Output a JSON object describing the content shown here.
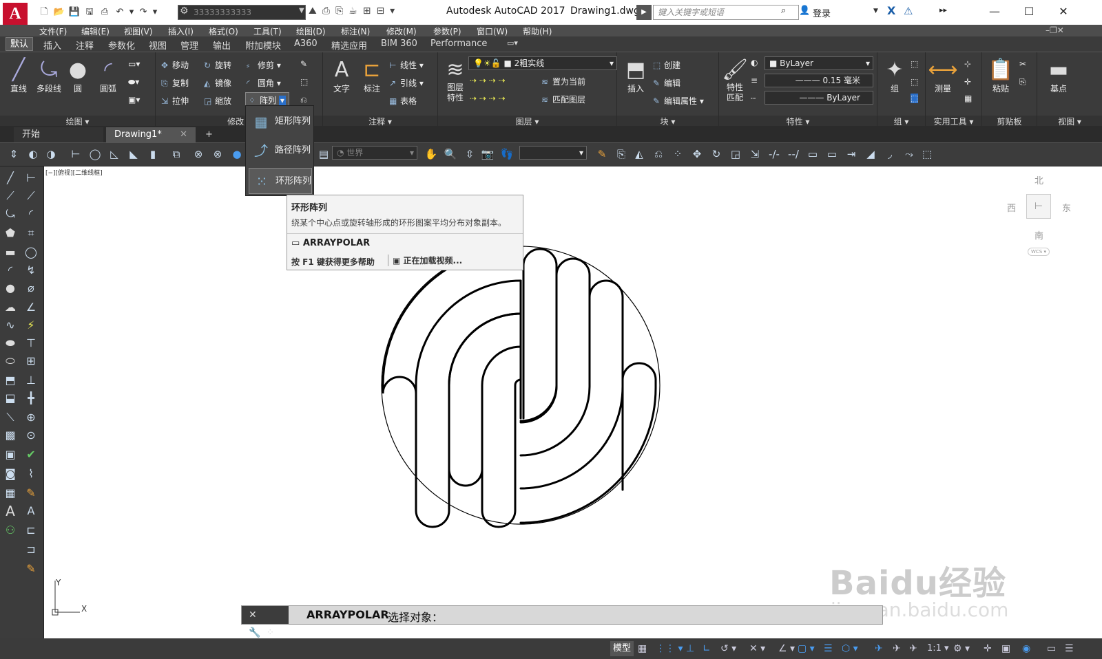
{
  "titlebar": {
    "app_logo": "A",
    "workspace": "33333333333",
    "app_name": "Autodesk AutoCAD 2017",
    "file_name": "Drawing1.dwg",
    "search_placeholder": "键入关键字或短语",
    "login": "登录"
  },
  "menu": [
    "文件(F)",
    "编辑(E)",
    "视图(V)",
    "插入(I)",
    "格式(O)",
    "工具(T)",
    "绘图(D)",
    "标注(N)",
    "修改(M)",
    "参数(P)",
    "窗口(W)",
    "帮助(H)"
  ],
  "ribbon_tabs": [
    "默认",
    "插入",
    "注释",
    "参数化",
    "视图",
    "管理",
    "输出",
    "附加模块",
    "A360",
    "精选应用",
    "BIM 360",
    "Performance"
  ],
  "draw": {
    "line": "直线",
    "polyline": "多段线",
    "circle": "圆",
    "arc": "圆弧",
    "title": "绘图"
  },
  "modify": {
    "move": "移动",
    "rotate": "旋转",
    "trim": "修剪",
    "copy": "复制",
    "mirror": "镜像",
    "fillet": "圆角",
    "stretch": "拉伸",
    "scale": "缩放",
    "array": "阵列",
    "title": "修改"
  },
  "annotation": {
    "text": "文字",
    "dim": "标注",
    "linear": "线性",
    "leader": "引线",
    "table": "表格",
    "title": "注释"
  },
  "layers": {
    "layer_props": "图层\n特性",
    "current_layer": "2粗实线",
    "set_current": "置为当前",
    "match_layer": "匹配图层",
    "title": "图层"
  },
  "block": {
    "insert": "插入",
    "create": "创建",
    "edit": "编辑",
    "edit_attr": "编辑属性",
    "title": "块"
  },
  "properties": {
    "match": "特性\n匹配",
    "color": "ByLayer",
    "lineweight": "0.15 毫米",
    "linetype": "ByLayer",
    "title": "特性"
  },
  "groups": {
    "group": "组",
    "title": "组"
  },
  "utilities": {
    "measure": "测量",
    "title": "实用工具"
  },
  "clipboard": {
    "paste": "粘贴",
    "title": "剪贴板"
  },
  "view": {
    "base": "基点",
    "title": "视图"
  },
  "doc_tabs": {
    "start": "开始",
    "drawing": "Drawing1*",
    "add": "+"
  },
  "toolbar2": {
    "ucs": "世界"
  },
  "array_menu": {
    "rect": "矩形阵列",
    "path": "路径阵列",
    "polar": "环形阵列"
  },
  "tooltip": {
    "title": "环形阵列",
    "desc": "绕某个中心点或旋转轴形成的环形图案平均分布对象副本。",
    "command": "ARRAYPOLAR",
    "help": "按 F1 键获得更多帮助",
    "video": "正在加载视频..."
  },
  "viewport_label": "[−][俯视][二维线框]",
  "viewcube": {
    "north": "北",
    "south": "南",
    "east": "东",
    "west": "西",
    "wcs": "WCS"
  },
  "ucs_icon": {
    "x": "X",
    "y": "Y"
  },
  "command_line": {
    "cmd": "ARRAYPOLAR",
    "prompt": "选择对象："
  },
  "statusbar": {
    "model": "模型",
    "scale": "1:1"
  },
  "watermark": {
    "brand": "Baidu经验",
    "url": "jingyan.baidu.com"
  }
}
